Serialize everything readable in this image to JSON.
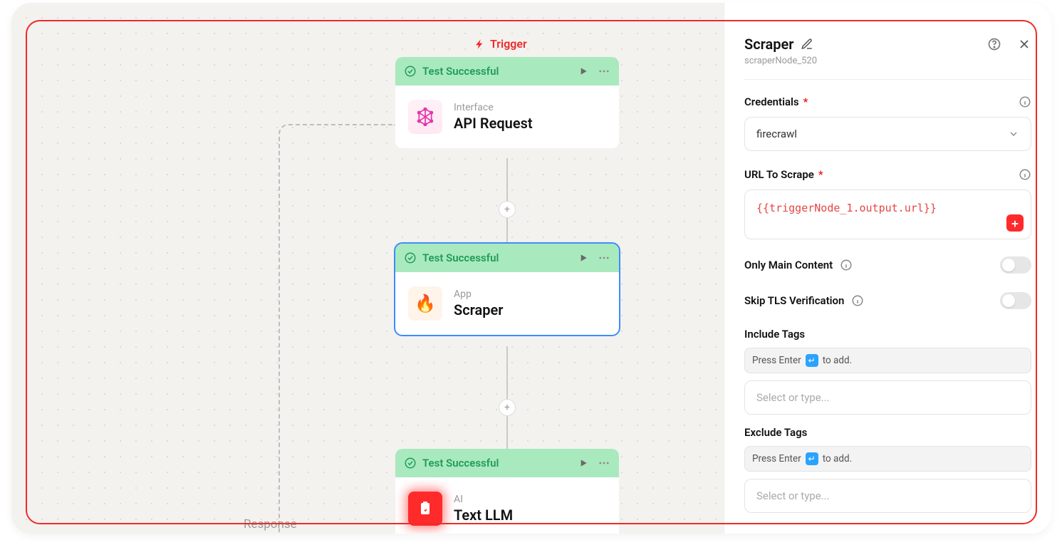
{
  "canvas": {
    "trigger_label": "Trigger",
    "response_label": "Response",
    "nodes": [
      {
        "status": "Test Successful",
        "category": "Interface",
        "title": "API Request",
        "icon": "graphql"
      },
      {
        "status": "Test Successful",
        "category": "App",
        "title": "Scraper",
        "icon": "fire"
      },
      {
        "status": "Test Successful",
        "category": "AI",
        "title": "Text LLM",
        "icon": "clipboard"
      }
    ]
  },
  "panel": {
    "title": "Scraper",
    "subtitle": "scraperNode_520",
    "credentials": {
      "label": "Credentials",
      "value": "firecrawl"
    },
    "url": {
      "label": "URL To Scrape",
      "value": "{{triggerNode_1.output.url}}"
    },
    "toggles": {
      "only_main": "Only Main Content",
      "skip_tls": "Skip TLS Verification"
    },
    "include": {
      "label": "Include Tags",
      "hint_pre": "Press Enter",
      "hint_post": "to add.",
      "placeholder": "Select or type..."
    },
    "exclude": {
      "label": "Exclude Tags",
      "hint_pre": "Press Enter",
      "hint_post": "to add.",
      "placeholder": "Select or type..."
    }
  }
}
